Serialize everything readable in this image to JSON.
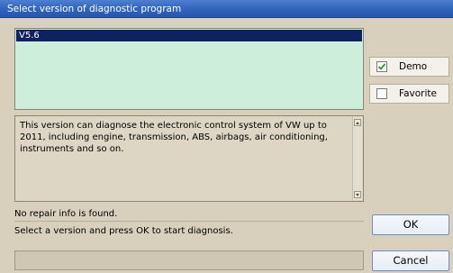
{
  "window": {
    "title": "Select version of diagnostic program"
  },
  "versions": {
    "items": [
      "V5.6"
    ],
    "selected_index": 0
  },
  "description": {
    "text": "This version can diagnose the electronic control system of VW up to 2011, including engine, transmission, ABS, airbags, air conditioning, instruments and so on."
  },
  "options": {
    "demo": {
      "label": "Demo",
      "checked": true
    },
    "favorite": {
      "label": "Favorite",
      "checked": false
    }
  },
  "status": {
    "repair_info": "No repair info is found.",
    "instruction": "Select a version and press OK to start diagnosis."
  },
  "buttons": {
    "ok": "OK",
    "cancel": "Cancel"
  },
  "colors": {
    "titlebar": "#3467be",
    "dialog_bg": "#d9cfbd",
    "list_bg": "#cdeedb",
    "selection": "#0e2161",
    "check_mark": "#2e9b2e"
  }
}
